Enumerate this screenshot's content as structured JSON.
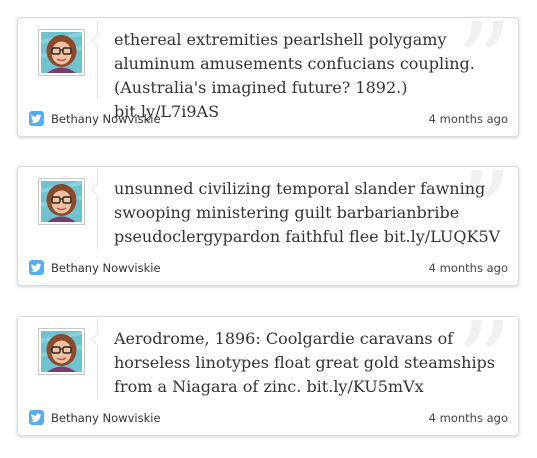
{
  "tweets": [
    {
      "text": "ethereal extremities pearlshell polygamy aluminum amusements confucians coupling. (Australia's imagined future? 1892.)",
      "link": "bit.ly/L7i9AS",
      "author": "Bethany Nowviskie",
      "time": "4 months ago"
    },
    {
      "text": "unsunned civilizing temporal slander fawning swooping ministering guilt barbarianbribe pseudoclergypardon faithful flee",
      "link": "bit.ly/LUQK5V",
      "author": "Bethany Nowviskie",
      "time": "4 months ago"
    },
    {
      "text": "Aerodrome, 1896: Coolgardie caravans of horseless linotypes float great gold steamships from a Niagara of zinc.",
      "link": "bit.ly/KU5mVx",
      "author": "Bethany Nowviskie",
      "time": "4 months ago"
    }
  ],
  "icons": {
    "twitter": "twitter-bird-icon",
    "quote": "quote-mark-icon"
  },
  "colors": {
    "twitter_blue": "#55acee",
    "text": "#333333",
    "border": "#dcdcdc"
  }
}
